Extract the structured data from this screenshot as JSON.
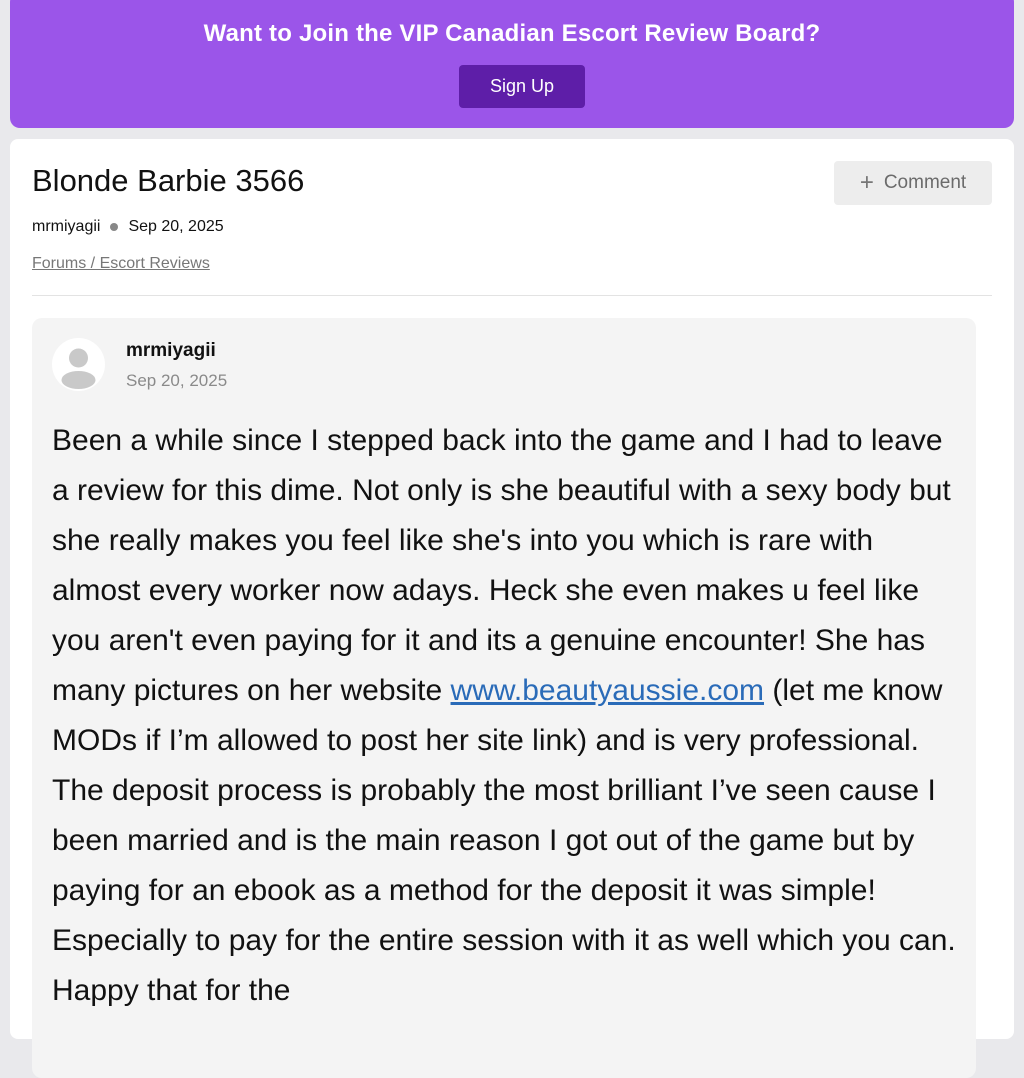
{
  "banner": {
    "title": "Want to Join the VIP Canadian Escort Review Board?",
    "signup_label": "Sign Up"
  },
  "thread": {
    "title": "Blonde Barbie 3566",
    "author": "mrmiyagii",
    "date": "Sep 20, 2025",
    "breadcrumb": "Forums / Escort Reviews",
    "comment_label": "Comment"
  },
  "post": {
    "author": "mrmiyagii",
    "date": "Sep 20, 2025",
    "text_before_link": "Been a while since I stepped back into the game and I had to leave a review for this dime. Not only is she beautiful with a sexy body but she really makes you feel like she's into you which is rare with almost every worker now adays. Heck she even makes u feel like you aren't even paying for it and its a genuine encounter! She has many pictures on her website ",
    "link_text": "www.beautyaussie.com",
    "text_after_link": " (let me know MODs if I’m allowed to post her site link) and is very professional. The deposit process is probably the most brilliant I’ve seen cause I been married and is the main reason I got out of the game but by paying for an ebook as a method for the deposit it was simple! Especially to pay for the entire session with it as well which you can. Happy that for the"
  },
  "colors": {
    "banner_bg": "#9b55e9",
    "signup_bg": "#5e1ea8",
    "link": "#2a6bb8",
    "post_bg": "#f4f4f4"
  },
  "icons": {
    "comment": "plus-icon",
    "meta_separator": "dot-icon",
    "avatar": "user-avatar-icon"
  }
}
